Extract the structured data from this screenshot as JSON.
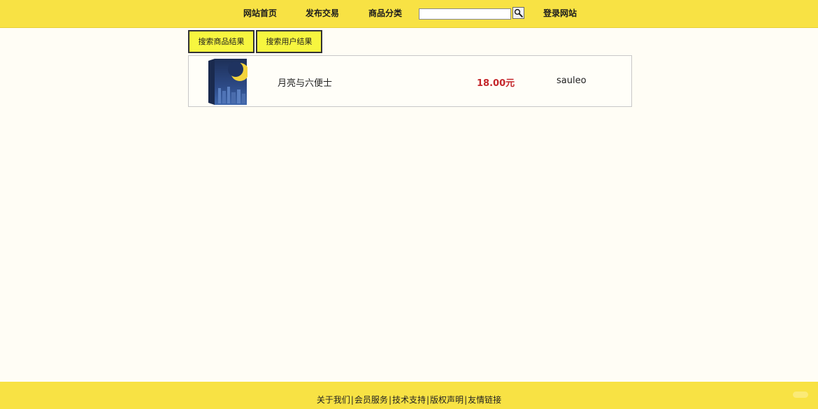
{
  "nav": {
    "home": "网站首页",
    "publish": "发布交易",
    "categories": "商品分类",
    "login": "登录网站"
  },
  "search": {
    "value": "",
    "placeholder": "",
    "button_icon": "magnifier-icon"
  },
  "tabs": [
    {
      "label": "搜索商品结果"
    },
    {
      "label": "搜索用户结果"
    }
  ],
  "results": [
    {
      "thumbnail_text": "月亮与六便士",
      "title": "月亮与六便士",
      "price": "18.00元",
      "seller": "sauleo"
    }
  ],
  "footer": {
    "links": [
      "关于我们",
      "会员服务",
      "技术支持",
      "版权声明",
      "友情链接"
    ],
    "separator": "|"
  },
  "colors": {
    "header_bg": "#f8e244",
    "tab_bg": "#f7f63f",
    "price": "#c4262a",
    "page_bg": "#fffdf5"
  }
}
